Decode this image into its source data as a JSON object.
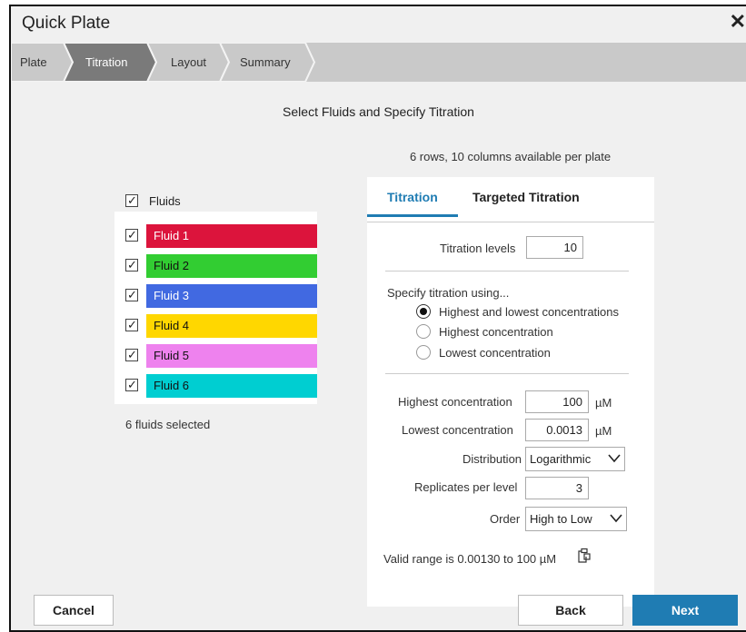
{
  "window": {
    "title": "Quick Plate"
  },
  "steps": [
    {
      "label": "Plate"
    },
    {
      "label": "Titration"
    },
    {
      "label": "Layout"
    },
    {
      "label": "Summary"
    }
  ],
  "heading": "Select Fluids and Specify Titration",
  "rows_info": "6 rows, 10 columns available per plate",
  "fluids": {
    "header_label": "Fluids",
    "items": [
      {
        "label": "Fluid 1",
        "color": "#dc143c",
        "text_color": "#ffffff",
        "checked": true
      },
      {
        "label": "Fluid 2",
        "color": "#32cd32",
        "text_color": "#111111",
        "checked": true
      },
      {
        "label": "Fluid 3",
        "color": "#4169e1",
        "text_color": "#ffffff",
        "checked": true
      },
      {
        "label": "Fluid 4",
        "color": "#ffd700",
        "text_color": "#111111",
        "checked": true
      },
      {
        "label": "Fluid 5",
        "color": "#ee82ee",
        "text_color": "#111111",
        "checked": true
      },
      {
        "label": "Fluid 6",
        "color": "#00ced1",
        "text_color": "#111111",
        "checked": true
      }
    ],
    "selected_summary": "6 fluids selected"
  },
  "tabs": [
    {
      "label": "Titration",
      "active": true
    },
    {
      "label": "Targeted Titration",
      "active": false
    }
  ],
  "titration": {
    "levels_label": "Titration levels",
    "levels_value": "10",
    "specify_label": "Specify titration using...",
    "options": [
      {
        "label": "Highest and lowest concentrations",
        "checked": true
      },
      {
        "label": "Highest concentration",
        "checked": false
      },
      {
        "label": "Lowest concentration",
        "checked": false
      }
    ],
    "highest_label": "Highest concentration",
    "highest_value": "100",
    "highest_unit": "µM",
    "lowest_label": "Lowest concentration",
    "lowest_value": "0.0013",
    "lowest_unit": "µM",
    "distribution_label": "Distribution",
    "distribution_value": "Logarithmic",
    "replicates_label": "Replicates per level",
    "replicates_value": "3",
    "order_label": "Order",
    "order_value": "High to Low",
    "valid_range": "Valid range is 0.00130 to 100 µM",
    "copy_icon": "copy-icon"
  },
  "colors": {
    "accent": "#1f7cb3",
    "step_active": "#7a7a7a",
    "step_inactive": "#c9c9c9"
  },
  "buttons": {
    "cancel": "Cancel",
    "back": "Back",
    "next": "Next"
  }
}
